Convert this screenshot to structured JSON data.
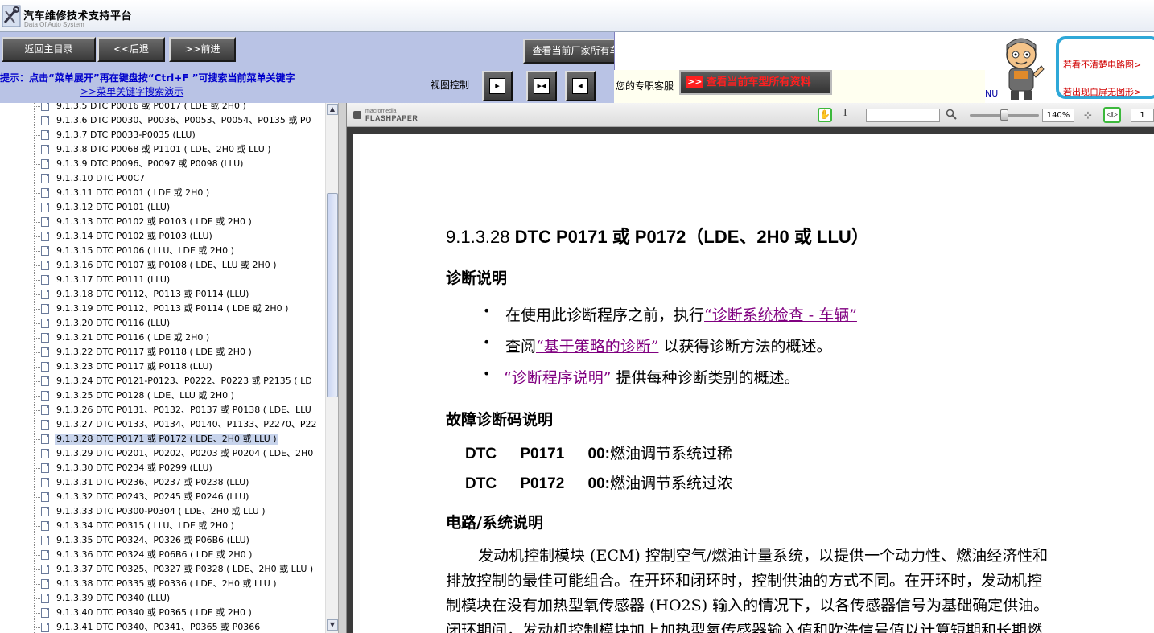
{
  "app": {
    "title": "汽车维修技术支持平台",
    "subtitle": "Data Of Auto System"
  },
  "toolbar": {
    "home_label": "返回主目录",
    "back_label": "<<后退",
    "forward_label": ">>前进",
    "all_models_label": "查看当前厂家所有车型",
    "all_info_arrow": ">>",
    "all_info_label": "查看当前车型所有资料",
    "tip": "提示：点击“菜单展开”再在键盘按“Ctrl+F ”可搜索当前菜单关键字",
    "tip_link": ">>菜单关键字搜索演示",
    "view_control_label": "视图控制",
    "service_text": "您的专职客服",
    "help_line1": "若看不清楚电路图>",
    "help_line2": "若出现白屏无图形>",
    "nu_text": "NU"
  },
  "tree": {
    "items": [
      {
        "label": "9.1.3.5 DTC P0016 或 P0017 ( LDE 或 2H0 )"
      },
      {
        "label": "9.1.3.6 DTC P0030、P0036、P0053、P0054、P0135 或 P0"
      },
      {
        "label": "9.1.3.7 DTC P0033-P0035 (LLU)"
      },
      {
        "label": "9.1.3.8 DTC P0068 或 P1101 ( LDE、2H0 或 LLU )"
      },
      {
        "label": "9.1.3.9 DTC P0096、P0097 或 P0098 (LLU)"
      },
      {
        "label": "9.1.3.10 DTC P00C7"
      },
      {
        "label": "9.1.3.11 DTC P0101 ( LDE 或 2H0 )"
      },
      {
        "label": "9.1.3.12 DTC P0101 (LLU)"
      },
      {
        "label": "9.1.3.13 DTC P0102 或 P0103 ( LDE 或 2H0 )"
      },
      {
        "label": "9.1.3.14 DTC P0102 或 P0103 (LLU)"
      },
      {
        "label": "9.1.3.15 DTC P0106 ( LLU、LDE 或 2H0 )"
      },
      {
        "label": "9.1.3.16 DTC P0107 或 P0108 ( LDE、LLU 或 2H0 )"
      },
      {
        "label": "9.1.3.17 DTC P0111 (LLU)"
      },
      {
        "label": "9.1.3.18 DTC P0112、P0113 或 P0114 (LLU)"
      },
      {
        "label": "9.1.3.19 DTC P0112、P0113 或 P0114 ( LDE 或 2H0 )"
      },
      {
        "label": "9.1.3.20 DTC P0116 (LLU)"
      },
      {
        "label": "9.1.3.21 DTC P0116 ( LDE 或 2H0 )"
      },
      {
        "label": "9.1.3.22 DTC P0117 或 P0118 ( LDE 或 2H0 )"
      },
      {
        "label": "9.1.3.23 DTC P0117 或 P0118 (LLU)"
      },
      {
        "label": "9.1.3.24 DTC P0121-P0123、P0222、P0223 或 P2135 ( LD"
      },
      {
        "label": "9.1.3.25 DTC P0128 ( LDE、LLU 或 2H0 )"
      },
      {
        "label": "9.1.3.26 DTC P0131、P0132、P0137 或 P0138 ( LDE、LLU"
      },
      {
        "label": "9.1.3.27 DTC P0133、P0134、P0140、P1133、P2270、P22"
      },
      {
        "label": "9.1.3.28 DTC P0171 或 P0172 ( LDE、2H0 或 LLU )"
      },
      {
        "label": "9.1.3.29 DTC P0201、P0202、P0203 或 P0204 ( LDE、2H0"
      },
      {
        "label": "9.1.3.30 DTC P0234 或 P0299 (LLU)"
      },
      {
        "label": "9.1.3.31 DTC P0236、P0237 或 P0238 (LLU)"
      },
      {
        "label": "9.1.3.32 DTC P0243、P0245 或 P0246 (LLU)"
      },
      {
        "label": "9.1.3.33 DTC P0300-P0304 ( LDE、2H0 或 LLU )"
      },
      {
        "label": "9.1.3.34 DTC P0315 ( LLU、LDE 或 2H0 )"
      },
      {
        "label": "9.1.3.35 DTC P0324、P0326 或 P06B6 (LLU)"
      },
      {
        "label": "9.1.3.36 DTC P0324 或 P06B6 ( LDE 或 2H0 )"
      },
      {
        "label": "9.1.3.37 DTC P0325、P0327 或 P0328 ( LDE、2H0 或 LLU )"
      },
      {
        "label": "9.1.3.38 DTC P0335 或 P0336 ( LDE、2H0 或 LLU )"
      },
      {
        "label": "9.1.3.39 DTC P0340 (LLU)"
      },
      {
        "label": "9.1.3.40 DTC P0340 或 P0365 ( LDE 或 2H0 )"
      },
      {
        "label": "9.1.3.41 DTC P0340、P0341、P0365 或 P0366"
      }
    ],
    "selected_index": 23
  },
  "viewer": {
    "logo_small": "macromedia",
    "logo_big": "FLASHPAPER",
    "zoom": "140%",
    "zoom_level_fraction": 0.5,
    "page": "1"
  },
  "doc": {
    "title_num": "9.1.3.28 ",
    "title_main": "DTC P0171 或 P0172（LDE、2H0 或 LLU）",
    "h_diag": "诊断说明",
    "b1_pre": "在使用此诊断程序之前，执行",
    "b1_link": "“诊断系统检查 - 车辆”",
    "b2_pre": "查阅",
    "b2_link": "“基于策略的诊断”",
    "b2_post": " 以获得诊断方法的概述。",
    "b3_link": "“诊断程序说明”",
    "b3_post": " 提供每种诊断类别的概述。",
    "h_dtc": "故障诊断码说明",
    "dtc1_code": "DTC P0171 00:",
    "dtc1_desc": "燃油调节系统过稀",
    "dtc2_code": "DTC P0172 00:",
    "dtc2_desc": "燃油调节系统过浓",
    "h_circuit": "电路/系统说明",
    "para1": "发动机控制模块 (ECM) 控制空气/燃油计量系统，以提供一个动力性、燃油经济性和",
    "para2": "排放控制的最佳可能组合。在开环和闭环时，控制供油的方式不同。在开环时，发动机控",
    "para3": "制模块在没有加热型氧传感器 (HO2S) 输入的情况下，以各传感器信号为基础确定供油。",
    "para4": "闭环期间，发动机控制模块加上加热型氧传感器输入值和吹洗信号值以计算短期和长期燃"
  }
}
